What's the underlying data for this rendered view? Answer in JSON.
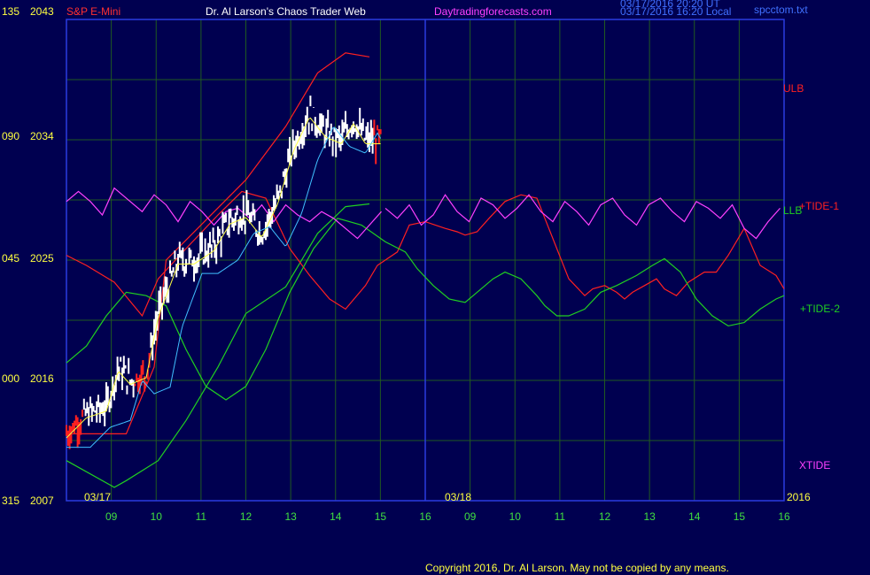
{
  "header": {
    "instrument": "S&P E-Mini",
    "instrument_color": "#ff3030",
    "title": "Dr. Al Larson's Chaos Trader Web",
    "title_color": "#ffffff",
    "site": "Daytradingforecasts.com",
    "site_color": "#ff40ff",
    "timestamp_ut": "03/17/2016 20:20 UT",
    "timestamp_local": "03/17/2016 16:20 Local",
    "filename": "spcctom.txt"
  },
  "footer": {
    "copyright": "Copyright 2016, Dr. Al Larson. May not be copied by any means."
  },
  "colors": {
    "background": "#000050",
    "grid": "#205a20",
    "frame": "#2a3ce0",
    "axis_text": "#ffff40",
    "tide1": "#ff2020",
    "tide2": "#20d020",
    "xtide": "#ff40ff",
    "price_up": "#ffffff",
    "price_down": "#ff2020",
    "ma_fast": "#ffff40",
    "ma_slow": "#40c0ff"
  },
  "chart_data": {
    "type": "line",
    "left_axis": {
      "tide_ticks": [
        "135",
        "090",
        "045",
        "000",
        "315"
      ],
      "price_ticks": [
        "2043",
        "2034",
        "2025",
        "2016",
        "2007"
      ],
      "price_range": [
        2007,
        2043
      ]
    },
    "x_axis": {
      "date_labels": [
        "03/17",
        "03/18"
      ],
      "hour_labels": [
        "09",
        "10",
        "11",
        "12",
        "13",
        "14",
        "15",
        "16",
        "09",
        "10",
        "11",
        "12",
        "13",
        "14",
        "15",
        "16"
      ],
      "year_label": "2016",
      "day_divider_hour": 8
    },
    "right_labels": [
      {
        "text": "ULB",
        "color": "#ff2020"
      },
      {
        "text": "+TIDE-1",
        "color": "#ff2020"
      },
      {
        "text": "LLB",
        "color": "#20d020"
      },
      {
        "text": "+TIDE-2",
        "color": "#20d020"
      },
      {
        "text": "XTIDE",
        "color": "#ff40ff"
      }
    ],
    "series": [
      {
        "name": "ULB",
        "color": "#ff2020",
        "unit": "price",
        "points": [
          [
            8.0,
            2012
          ],
          [
            9.5,
            2012
          ],
          [
            10.2,
            2017
          ],
          [
            10.5,
            2025
          ],
          [
            11.5,
            2028
          ],
          [
            12.5,
            2031
          ],
          [
            13.5,
            2035
          ],
          [
            14.3,
            2039
          ],
          [
            15.0,
            2040.5
          ],
          [
            15.6,
            2040.2
          ]
        ]
      },
      {
        "name": "LLB",
        "color": "#20d020",
        "unit": "price",
        "points": [
          [
            8.0,
            2010
          ],
          [
            9.2,
            2008
          ],
          [
            9.5,
            2008.5
          ],
          [
            10.3,
            2010
          ],
          [
            11,
            2013
          ],
          [
            11.8,
            2017
          ],
          [
            12.5,
            2021
          ],
          [
            13.5,
            2023
          ],
          [
            14.3,
            2027
          ],
          [
            15.0,
            2029
          ],
          [
            15.6,
            2029.2
          ]
        ]
      },
      {
        "name": "+TIDE-1",
        "color": "#ff2020",
        "unit": "tide",
        "points": [
          [
            8.0,
            0.3
          ],
          [
            8.5,
            0.0
          ],
          [
            9.2,
            -0.5
          ],
          [
            9.9,
            -1.5
          ],
          [
            10.3,
            -0.4
          ],
          [
            11,
            0.5
          ],
          [
            11.8,
            1.5
          ],
          [
            12.4,
            2.2
          ],
          [
            13.0,
            2.0
          ],
          [
            13.6,
            0.5
          ],
          [
            14.1,
            -0.3
          ],
          [
            14.6,
            -1.0
          ],
          [
            15.0,
            -1.3
          ],
          [
            15.5,
            -0.6
          ],
          [
            15.8,
            0.0
          ],
          [
            16.3,
            0.4
          ],
          [
            16.6,
            1.2
          ],
          [
            17.0,
            1.3
          ],
          [
            17.5,
            1.1
          ],
          [
            17.8,
            1.0
          ],
          [
            18.0,
            0.9
          ],
          [
            18.3,
            1.0
          ],
          [
            18.6,
            1.4
          ],
          [
            19.0,
            1.9
          ],
          [
            19.4,
            2.1
          ],
          [
            19.8,
            2.0
          ],
          [
            20.0,
            1.4
          ],
          [
            20.3,
            0.5
          ],
          [
            20.6,
            -0.4
          ],
          [
            21.0,
            -0.9
          ],
          [
            21.2,
            -0.7
          ],
          [
            21.5,
            -0.6
          ],
          [
            21.8,
            -0.8
          ],
          [
            22.0,
            -1.0
          ],
          [
            22.2,
            -0.8
          ],
          [
            22.5,
            -0.6
          ],
          [
            22.8,
            -0.4
          ],
          [
            23.0,
            -0.7
          ],
          [
            23.3,
            -0.9
          ],
          [
            23.6,
            -0.5
          ],
          [
            24.0,
            -0.2
          ],
          [
            24.3,
            -0.2
          ],
          [
            24.6,
            0.3
          ],
          [
            25.0,
            1.1
          ],
          [
            25.4,
            0.0
          ],
          [
            25.8,
            -0.3
          ],
          [
            26.0,
            -0.7
          ]
        ]
      },
      {
        "name": "+TIDE-2",
        "color": "#20d020",
        "unit": "tide",
        "points": [
          [
            8.0,
            -2.9
          ],
          [
            8.5,
            -2.4
          ],
          [
            9.0,
            -1.5
          ],
          [
            9.5,
            -0.8
          ],
          [
            10.0,
            -0.9
          ],
          [
            10.5,
            -1.2
          ],
          [
            11.0,
            -2.5
          ],
          [
            11.5,
            -3.6
          ],
          [
            12.0,
            -4.0
          ],
          [
            12.5,
            -3.6
          ],
          [
            13.0,
            -2.5
          ],
          [
            13.6,
            -0.8
          ],
          [
            14.2,
            0.5
          ],
          [
            14.8,
            1.4
          ],
          [
            15.4,
            1.2
          ],
          [
            16.0,
            0.7
          ],
          [
            16.5,
            0.4
          ],
          [
            16.8,
            -0.1
          ],
          [
            17.2,
            -0.6
          ],
          [
            17.6,
            -1.0
          ],
          [
            18.0,
            -1.1
          ],
          [
            18.3,
            -0.8
          ],
          [
            18.7,
            -0.4
          ],
          [
            19.0,
            -0.2
          ],
          [
            19.4,
            -0.4
          ],
          [
            19.8,
            -0.9
          ],
          [
            20.0,
            -1.2
          ],
          [
            20.3,
            -1.5
          ],
          [
            20.6,
            -1.5
          ],
          [
            21.0,
            -1.3
          ],
          [
            21.4,
            -0.8
          ],
          [
            21.8,
            -0.6
          ],
          [
            22.3,
            -0.3
          ],
          [
            22.7,
            0.0
          ],
          [
            23.0,
            0.2
          ],
          [
            23.4,
            -0.2
          ],
          [
            23.8,
            -1.0
          ],
          [
            24.2,
            -1.5
          ],
          [
            24.6,
            -1.8
          ],
          [
            25.0,
            -1.7
          ],
          [
            25.4,
            -1.3
          ],
          [
            25.8,
            -1.0
          ],
          [
            26.0,
            -0.9
          ]
        ]
      },
      {
        "name": "XTIDE",
        "color": "#ff40ff",
        "unit": "tide",
        "points": [
          [
            8.0,
            1.9
          ],
          [
            8.3,
            2.2
          ],
          [
            8.6,
            1.9
          ],
          [
            8.9,
            1.5
          ],
          [
            9.2,
            2.3
          ],
          [
            9.6,
            1.9
          ],
          [
            9.9,
            1.6
          ],
          [
            10.2,
            2.1
          ],
          [
            10.5,
            1.8
          ],
          [
            10.8,
            1.3
          ],
          [
            11.1,
            1.9
          ],
          [
            11.4,
            1.6
          ],
          [
            11.7,
            1.2
          ],
          [
            12.0,
            1.6
          ],
          [
            12.3,
            1.7
          ],
          [
            12.6,
            1.4
          ],
          [
            12.9,
            1.8
          ],
          [
            13.2,
            1.3
          ],
          [
            13.5,
            1.8
          ],
          [
            13.8,
            1.5
          ],
          [
            14.1,
            1.3
          ],
          [
            14.4,
            1.6
          ],
          [
            14.7,
            1.4
          ],
          [
            15.0,
            1.1
          ],
          [
            15.3,
            0.8
          ],
          [
            15.6,
            1.2
          ],
          [
            15.9,
            1.6
          ]
        ]
      }
    ],
    "price_range_hours": [
      8.0,
      15.9
    ]
  }
}
